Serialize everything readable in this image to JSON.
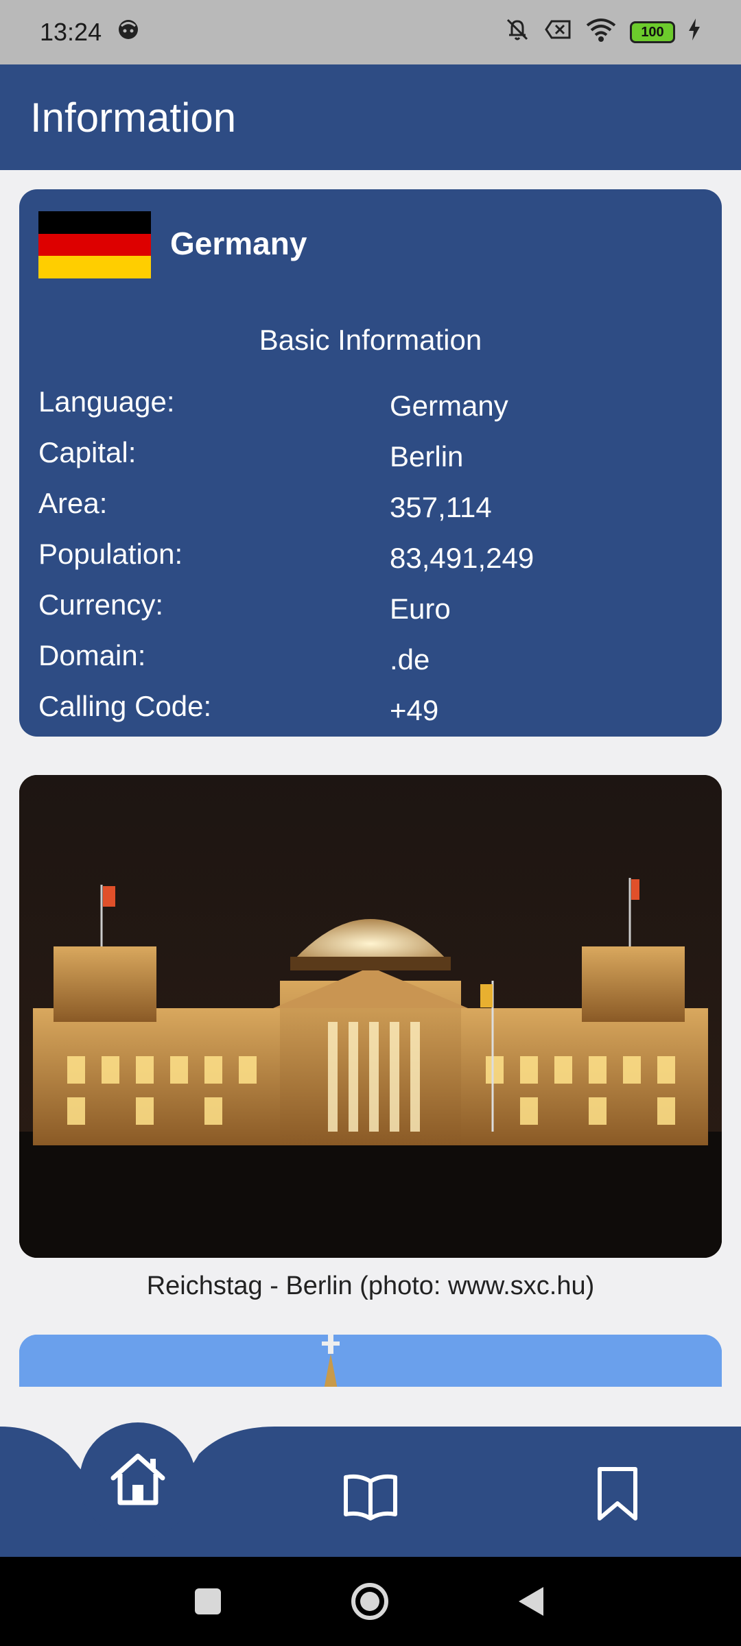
{
  "status_bar": {
    "time": "13:24",
    "battery": "100"
  },
  "app_bar": {
    "title": "Information"
  },
  "country": {
    "name": "Germany",
    "flag_colors": [
      "#000000",
      "#dd0000",
      "#ffce00"
    ]
  },
  "basic_info": {
    "title": "Basic Information",
    "rows": [
      {
        "label": "Language:",
        "value": "Germany"
      },
      {
        "label": "Capital:",
        "value": "Berlin"
      },
      {
        "label": "Area:",
        "value": "357,114"
      },
      {
        "label": "Population:",
        "value": "83,491,249"
      },
      {
        "label": "Currency:",
        "value": "Euro"
      },
      {
        "label": "Domain:",
        "value": ".de"
      },
      {
        "label": "Calling Code:",
        "value": "+49"
      }
    ]
  },
  "photo": {
    "caption": "Reichstag - Berlin (photo: www.sxc.hu)"
  },
  "bottom_nav": {
    "items": [
      {
        "icon": "home-icon"
      },
      {
        "icon": "book-icon"
      },
      {
        "icon": "bookmark-icon"
      }
    ]
  },
  "theme": {
    "primary": "#2e4c84",
    "background": "#f0f0f2"
  }
}
